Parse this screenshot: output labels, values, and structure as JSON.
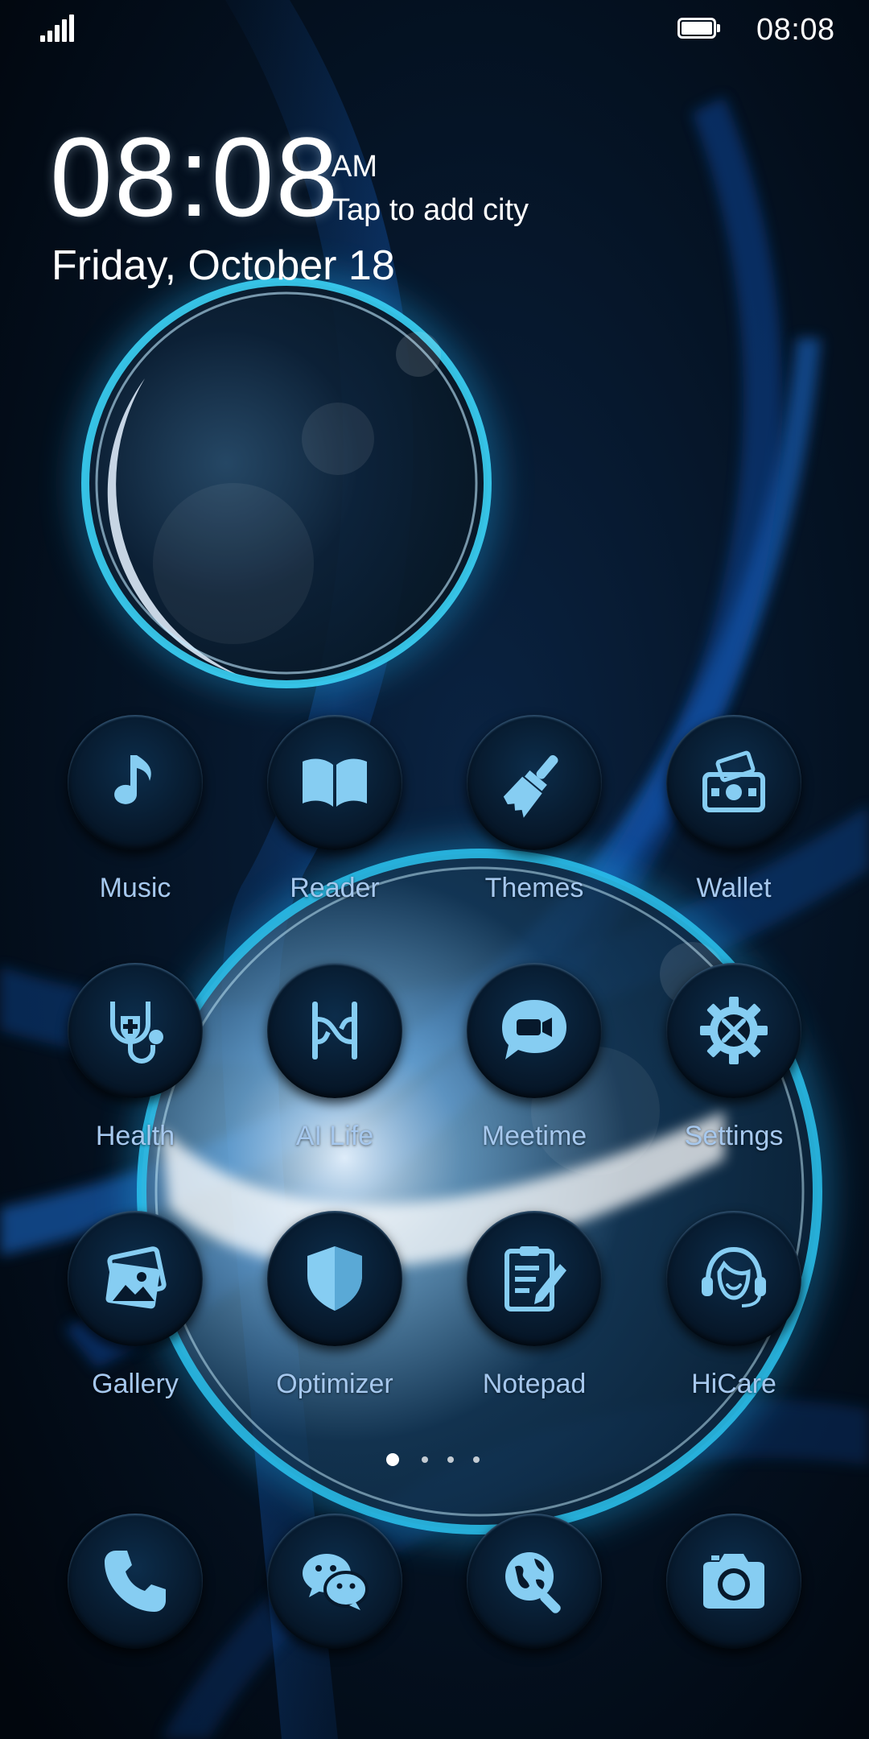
{
  "status_bar": {
    "time": "08:08",
    "signal_icon": "signal-bars-icon",
    "battery_icon": "battery-full-icon"
  },
  "clock_widget": {
    "time": "08:08",
    "ampm": "AM",
    "city": "Tap to add city",
    "date": "Friday, October 18"
  },
  "apps": [
    {
      "label": "Music",
      "icon": "music-note-icon"
    },
    {
      "label": "Reader",
      "icon": "book-icon"
    },
    {
      "label": "Themes",
      "icon": "paintbrush-icon"
    },
    {
      "label": "Wallet",
      "icon": "wallet-icon"
    },
    {
      "label": "Health",
      "icon": "stethoscope-icon"
    },
    {
      "label": "AI Life",
      "icon": "ai-life-icon"
    },
    {
      "label": "Meetime",
      "icon": "video-chat-icon"
    },
    {
      "label": "Settings",
      "icon": "gear-tools-icon"
    },
    {
      "label": "Gallery",
      "icon": "photos-icon"
    },
    {
      "label": "Optimizer",
      "icon": "shield-icon"
    },
    {
      "label": "Notepad",
      "icon": "notepad-icon"
    },
    {
      "label": "HiCare",
      "icon": "headset-icon"
    }
  ],
  "dock": [
    {
      "icon": "phone-icon"
    },
    {
      "icon": "wechat-icon"
    },
    {
      "icon": "browser-search-icon"
    },
    {
      "icon": "camera-icon"
    }
  ],
  "page_indicator": {
    "pages": 4,
    "current": 1
  },
  "colors": {
    "icon_glyph": "#86cdf2",
    "label": "#a6c8ee",
    "background": "#020812",
    "accent_glow": "#1ea6e6"
  }
}
